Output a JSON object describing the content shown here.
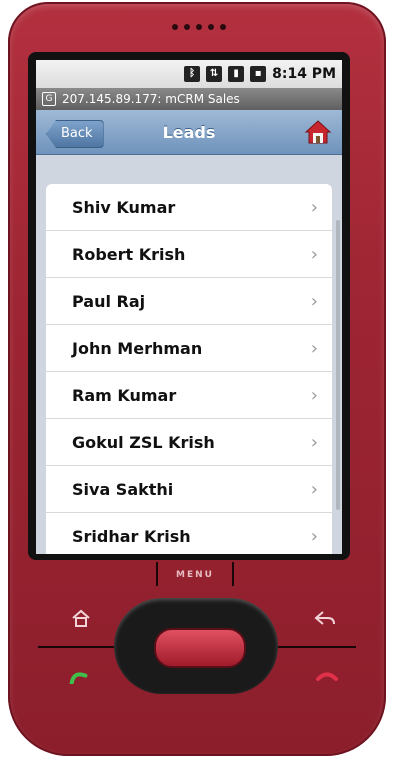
{
  "device": {
    "menu_label": "MENU",
    "colors": {
      "body": "#9e2533",
      "header": "#6f93bc"
    }
  },
  "status_bar": {
    "time": "8:14 PM",
    "icons": [
      "bluetooth-icon",
      "signal-icon",
      "network-icon",
      "battery-icon"
    ]
  },
  "browser_bar": {
    "title": "207.145.89.177: mCRM Sales"
  },
  "app_bar": {
    "back_label": "Back",
    "title": "Leads",
    "home_icon": "home-icon"
  },
  "leads": [
    {
      "name": "Shiv Kumar"
    },
    {
      "name": "Robert Krish"
    },
    {
      "name": "Paul Raj"
    },
    {
      "name": "John Merhman"
    },
    {
      "name": "Ram Kumar"
    },
    {
      "name": "Gokul ZSL Krish"
    },
    {
      "name": "Siva Sakthi"
    },
    {
      "name": "Sridhar Krish"
    }
  ],
  "chevron": "›"
}
